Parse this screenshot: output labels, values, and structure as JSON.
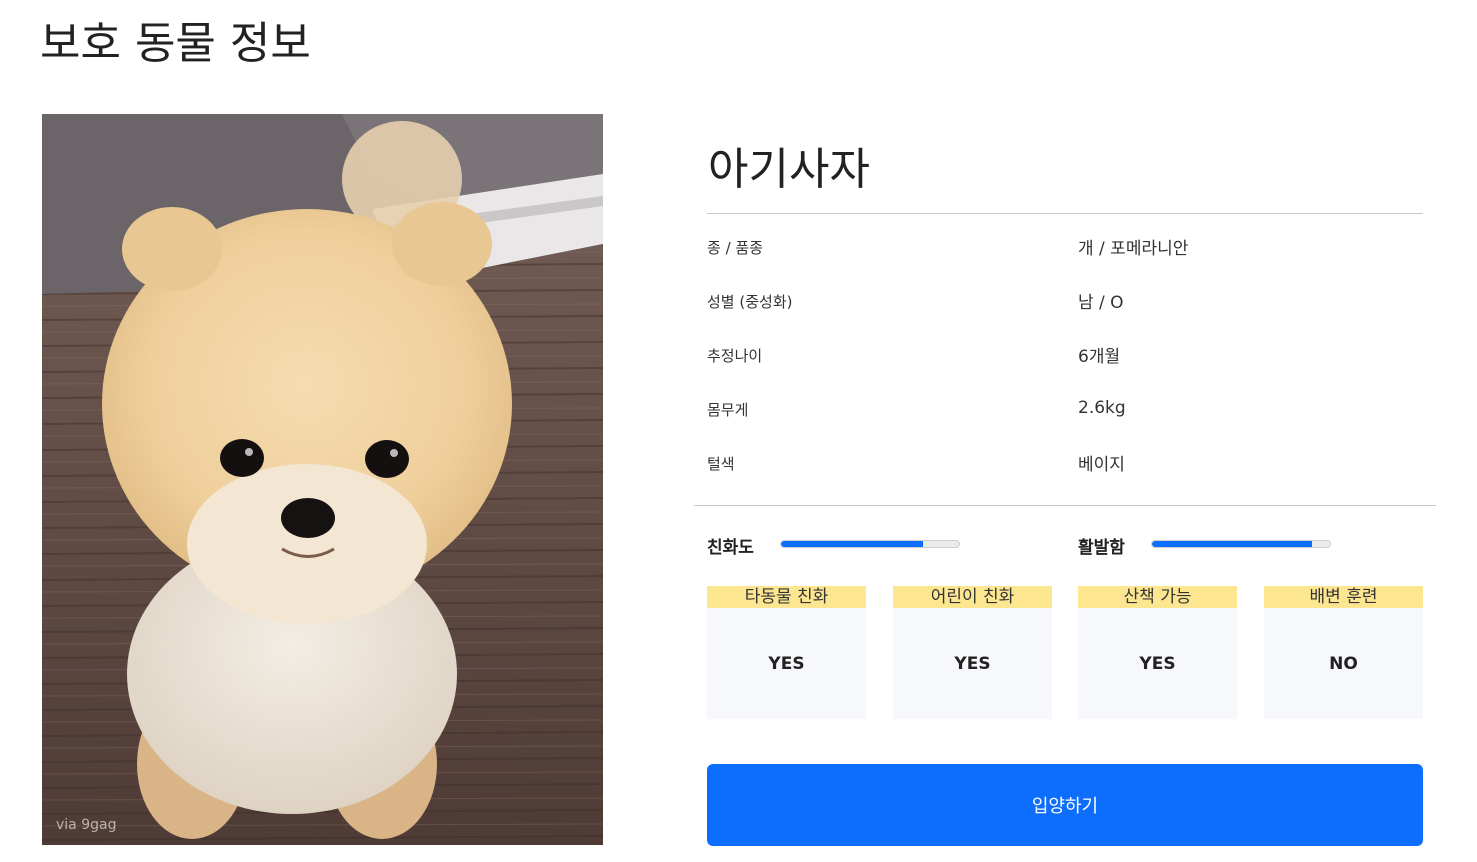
{
  "page": {
    "title": "보호 동물 정보"
  },
  "photo": {
    "credit": "via 9gag"
  },
  "animal": {
    "name": "아기사자",
    "info": [
      {
        "label": "종 / 품종",
        "value": "개 / 포메라니안"
      },
      {
        "label": "성별 (중성화)",
        "value": "남 / O"
      },
      {
        "label": "추정나이",
        "value": "6개월"
      },
      {
        "label": "몸무게",
        "value": "2.6kg"
      },
      {
        "label": "털색",
        "value": "베이지"
      }
    ]
  },
  "meters": [
    {
      "label": "친화도",
      "level": 0.8
    },
    {
      "label": "활발함",
      "level": 0.9
    }
  ],
  "traits": [
    {
      "label": "타동물 친화",
      "value": "YES"
    },
    {
      "label": "어린이 친화",
      "value": "YES"
    },
    {
      "label": "산책 가능",
      "value": "YES"
    },
    {
      "label": "배변 훈련",
      "value": "NO"
    }
  ],
  "actions": {
    "adopt_label": "입양하기"
  },
  "colors": {
    "accent": "#0d6efd",
    "trait_header": "#fde690",
    "card_background": "#f7f8fc"
  }
}
